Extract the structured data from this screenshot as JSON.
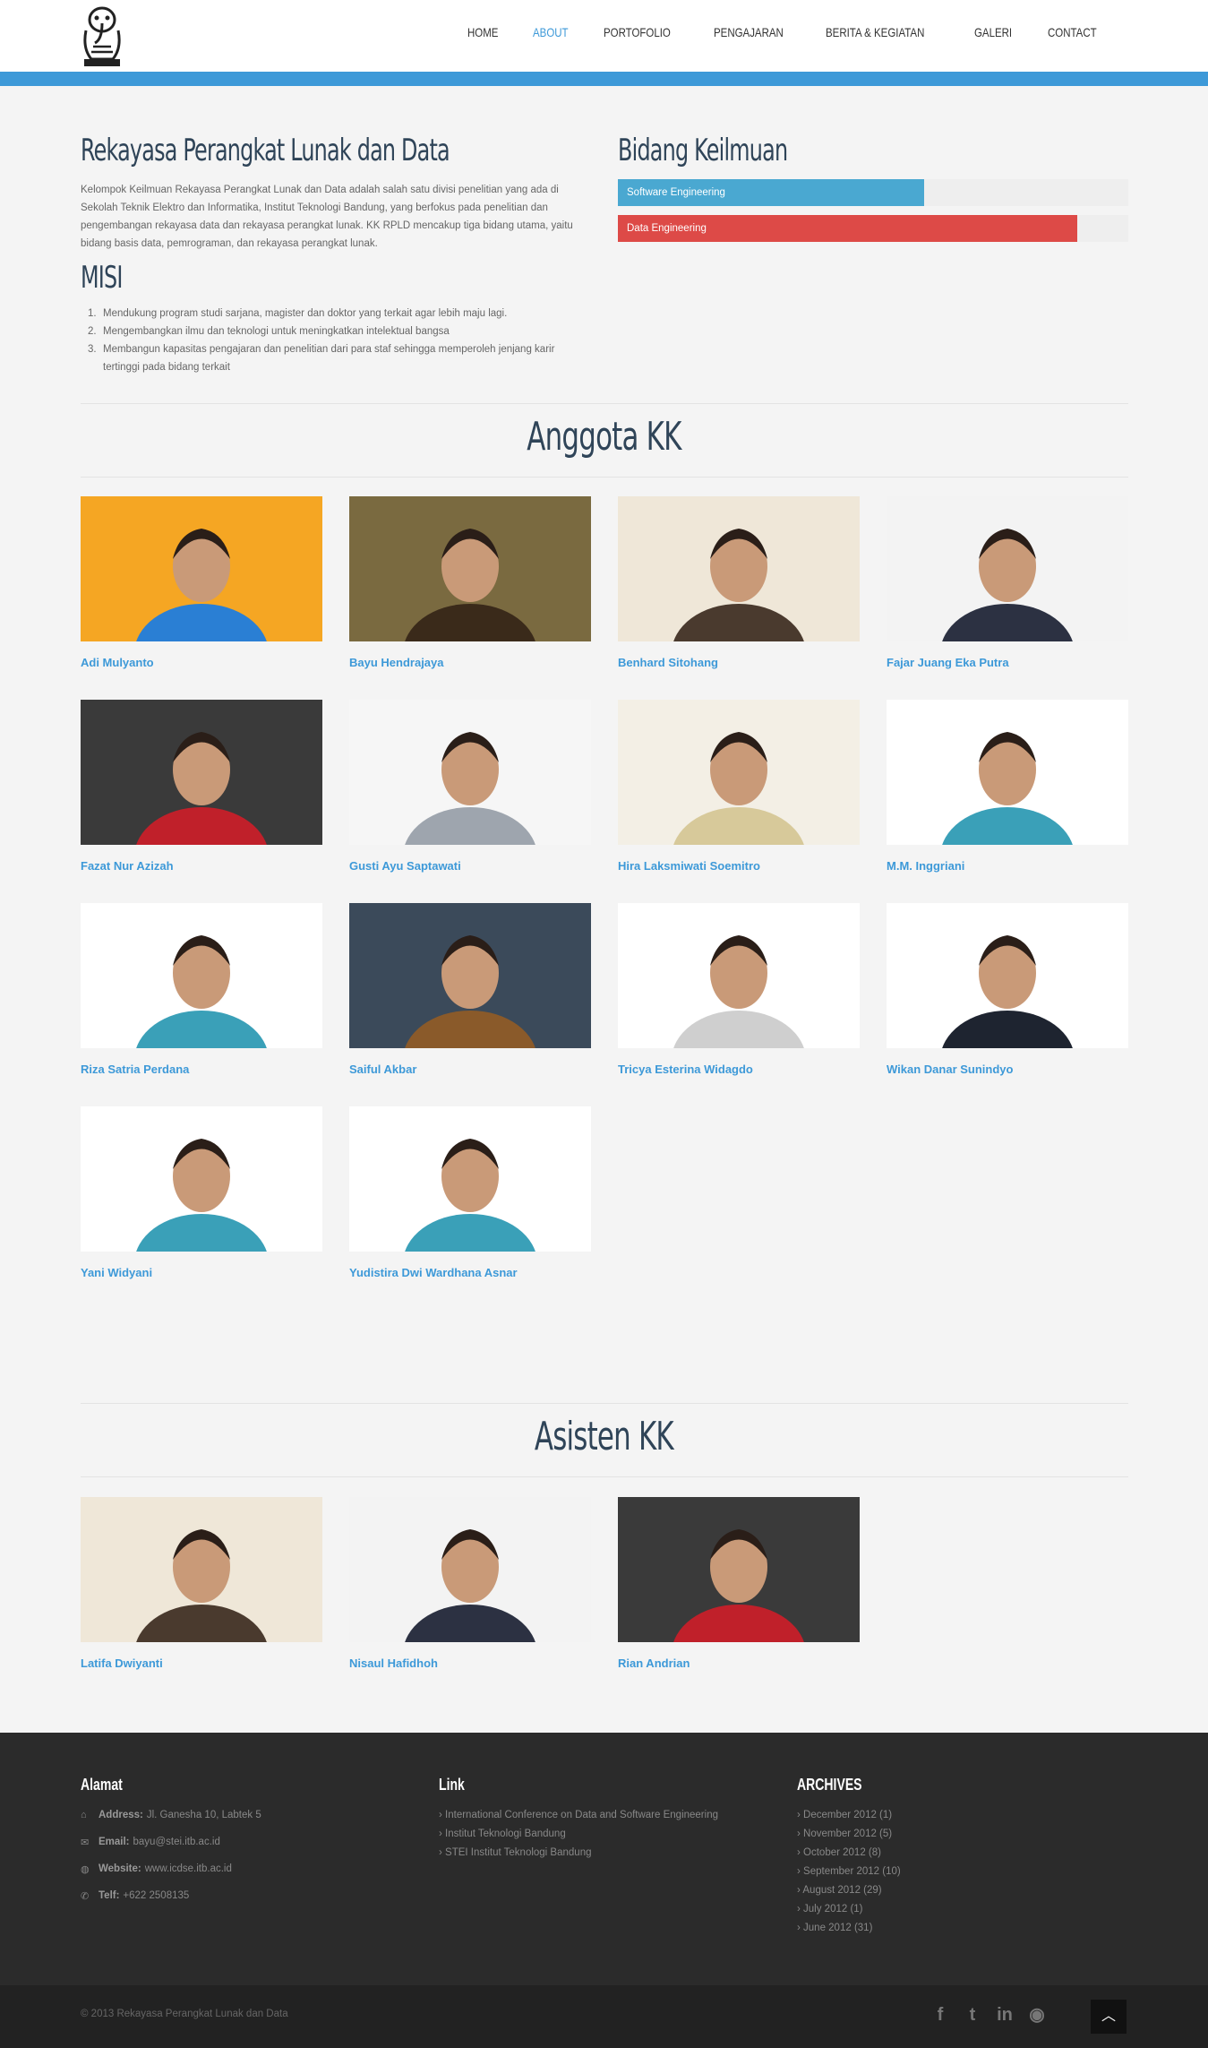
{
  "nav": {
    "items": [
      "HOME",
      "ABOUT",
      "PORTOFOLIO",
      "PENGAJARAN",
      "BERITA & KEGIATAN",
      "GALERI",
      "CONTACT"
    ],
    "active": "ABOUT"
  },
  "about": {
    "title": "Rekayasa Perangkat Lunak dan Data",
    "description": "Kelompok Keilmuan Rekayasa Perangkat Lunak dan Data adalah salah satu divisi penelitian yang ada di Sekolah Teknik Elektro dan Informatika, Institut Teknologi Bandung, yang berfokus pada penelitian dan pengembangan rekayasa data dan rekayasa perangkat lunak. KK RPLD mencakup tiga bidang utama, yaitu bidang basis data, pemrograman, dan rekayasa perangkat lunak."
  },
  "misi": {
    "title": "MISI",
    "items": [
      {
        "num": "1.",
        "text": "Mendukung program studi sarjana, magister dan doktor yang terkait agar lebih maju lagi."
      },
      {
        "num": "2.",
        "text": "Mengembangkan ilmu dan teknologi untuk meningkatkan intelektual bangsa"
      },
      {
        "num": "3.",
        "text": "Membangun kapasitas pengajaran dan penelitian dari para staf sehingga memperoleh jenjang karir tertinggi pada bidang terkait"
      }
    ]
  },
  "bidang": {
    "title": "Bidang Keilmuan",
    "skills": [
      {
        "label": "Software Engineering",
        "percent": 60,
        "color": "#4aa8d1"
      },
      {
        "label": "Data Engineering",
        "percent": 90,
        "color": "#dd4a47"
      }
    ]
  },
  "anggota": {
    "title": "Anggota KK",
    "members": [
      {
        "name": "Adi Mulyanto"
      },
      {
        "name": "Bayu Hendrajaya"
      },
      {
        "name": "Benhard Sitohang"
      },
      {
        "name": "Fajar Juang Eka Putra"
      },
      {
        "name": "Fazat Nur Azizah"
      },
      {
        "name": "Gusti Ayu Saptawati"
      },
      {
        "name": "Hira Laksmiwati Soemitro"
      },
      {
        "name": "M.M. Inggriani"
      },
      {
        "name": "Riza Satria Perdana"
      },
      {
        "name": "Saiful Akbar"
      },
      {
        "name": "Tricya Esterina Widagdo"
      },
      {
        "name": "Wikan Danar Sunindyo"
      },
      {
        "name": "Yani Widyani"
      },
      {
        "name": "Yudistira Dwi Wardhana Asnar"
      }
    ]
  },
  "asisten": {
    "title": "Asisten KK",
    "members": [
      {
        "name": "Latifa Dwiyanti"
      },
      {
        "name": "Nisaul Hafidhoh"
      },
      {
        "name": "Rian Andrian"
      }
    ]
  },
  "footer": {
    "alamat_title": "Alamat",
    "address_label": "Address:",
    "address": "Jl. Ganesha 10, Labtek 5",
    "email_label": "Email:",
    "email": "bayu@stei.itb.ac.id",
    "website_label": "Website:",
    "website": "www.icdse.itb.ac.id",
    "telf_label": "Telf:",
    "telf": "+622 2508135",
    "link_title": "Link",
    "links": [
      "International Conference on Data and Software Engineering",
      "Institut Teknologi Bandung",
      "STEI Institut Teknologi Bandung"
    ],
    "archives_title": "ARCHIVES",
    "archives": [
      "December 2012 (1)",
      "November 2012 (5)",
      "October 2012 (8)",
      "September 2012 (10)",
      "August 2012 (29)",
      "July 2012 (1)",
      "June 2012 (31)"
    ],
    "copyright": "© 2013 Rekayasa Perangkat Lunak dan Data"
  }
}
